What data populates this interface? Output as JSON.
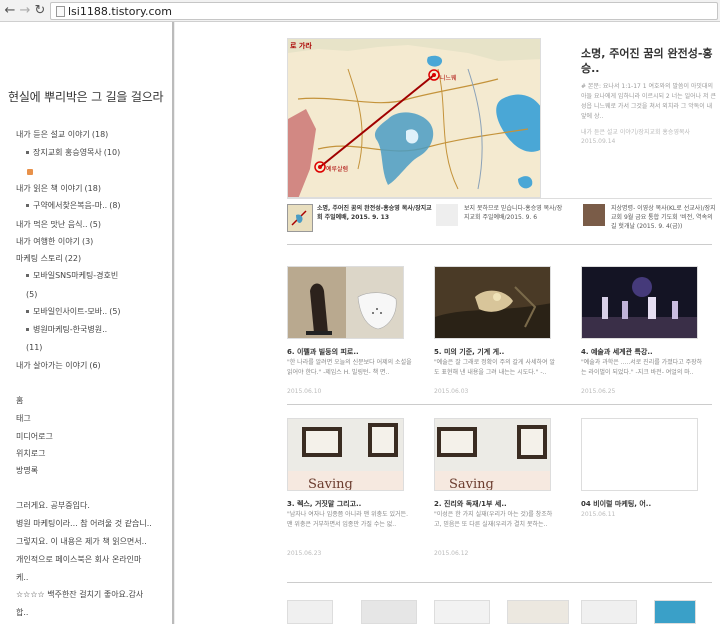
{
  "browser": {
    "url": "lsi1188.tistory.com"
  },
  "sidebar": {
    "title": "현실에 뿌리박은 그 길을 걸으라",
    "categories": [
      {
        "label": "내가 듣은 설교 이야기",
        "count": "(18)"
      },
      {
        "label": "장지교회 홍승영목사",
        "count": "(10)"
      },
      {
        "label": "내가 읽은 책 이야기",
        "count": "(18)"
      },
      {
        "label": "구약에서찾은복음-마..",
        "count": "(8)"
      },
      {
        "label": "내가 먹은 맛난 음식..",
        "count": "(5)"
      },
      {
        "label": "내가 여행한 이야기",
        "count": "(3)"
      },
      {
        "label": "마케팅 스토리",
        "count": "(22)"
      },
      {
        "label": "모바일SNS마케팅-경호빈",
        "count": ""
      },
      {
        "label": "(5)",
        "count": ""
      },
      {
        "label": "모바일인사이트-모바..",
        "count": "(5)"
      },
      {
        "label": "병원마케팅-한국병원..",
        "count": ""
      },
      {
        "label": "(11)",
        "count": ""
      },
      {
        "label": "내가 살아가는 이야기",
        "count": "(6)"
      }
    ],
    "menu": [
      "홈",
      "태그",
      "미디어로그",
      "위치로그",
      "방명록"
    ],
    "recent": [
      "그러게요. 공부중입다.",
      "병원 마케팅이라... 참 어려울 것 같습니..",
      "그렇지요. 이 내용은 제가 책 읽으면서..",
      "개인적으로 페이스북은 회사 온라인마",
      "케..",
      "☆☆☆☆ 백주한잔 걸치기 좋아요.감사",
      "합.."
    ]
  },
  "featured": {
    "map_label_top": "로 가라",
    "map_label_city1": "니느웨",
    "map_label_city2": "예루살렘",
    "title": "소명, 주어진 꿈의 완전성-홍승..",
    "desc": "# 본문: 요나서 1:1-17 1 여호와의 말씀이 아밋대의 아들 요나에게 임하니라 이르시되 2 너는 일어나 저 큰 성읍 니느웨로 가서 그것을 쳐서 외치라 그 악독이 내 앞에 상..",
    "meta1": "내가 듣은 설교 이야기/장지교회 홍승영목사",
    "meta2": "2015.09.14"
  },
  "mini_posts": [
    {
      "text": "소명, 주어진 꿈의 완전성-홍승영 목사/장지교회 주일예배, 2015. 9. 13"
    },
    {
      "text": "보지 못하므로 믿습니다-홍승영 목사/장지교회 주일예배/2015. 9. 6"
    },
    {
      "text": "지상명령- 이영상 목사(KL로 선교사)/장지교회 9월 금요 통합 기도회 '비전, 역속의 길 헛개날 (2015. 9. 4(금))"
    }
  ],
  "cards_row1": [
    {
      "title": "6. 이펠과 빌둥의 피로..",
      "desc": "\"한 나라를 알려면 오늘의 신문보다 어제의 소설을 읽어야 한다.\" -제임스 H. 빌링턴- 책 면..",
      "date": "2015.06.10"
    },
    {
      "title": "5. 미의 기준, 기계 게..",
      "desc": "\"예술은 잘 그래로 정확이 주의 갈게 사세하여 알도 표현해 낸 내용을 그려 내는는 시도다.\" -..",
      "date": "2015.06.03"
    },
    {
      "title": "4. 예술과 세계관 특강..",
      "desc": "\"예술과 과학은 .....서로 진리를 가졌다고 주장하는 라이벌이 되었다.\" -지크 바전- 여얼의 마..",
      "date": "2015.06.25"
    }
  ],
  "cards_row2": [
    {
      "title": "3. 렉스, 거짓말 그리고..",
      "desc": "\"남자나 여자나 임종쯤 아니라 맨 위충도 있거든. 맨 위충은 거부하면서 임종만 가질 수는 없..",
      "date": "2015.06.23"
    },
    {
      "title": "2. 진리와 독재/1부 세..",
      "desc": "\"이성은 한 가지 실재(우리가 아는 것)를 창조하고, 믿음은 또 다른 실재(우리가 결치 못하는..",
      "date": "2015.06.12"
    },
    {
      "title": "04 비이럴 마케팅, 어..",
      "desc": "",
      "date": "2015.06.11"
    }
  ],
  "card_image_texts": {
    "saving1": "Saving",
    "saving2": "Saving"
  },
  "colors": {
    "accent": "#333333",
    "rss": "#e8914a"
  }
}
